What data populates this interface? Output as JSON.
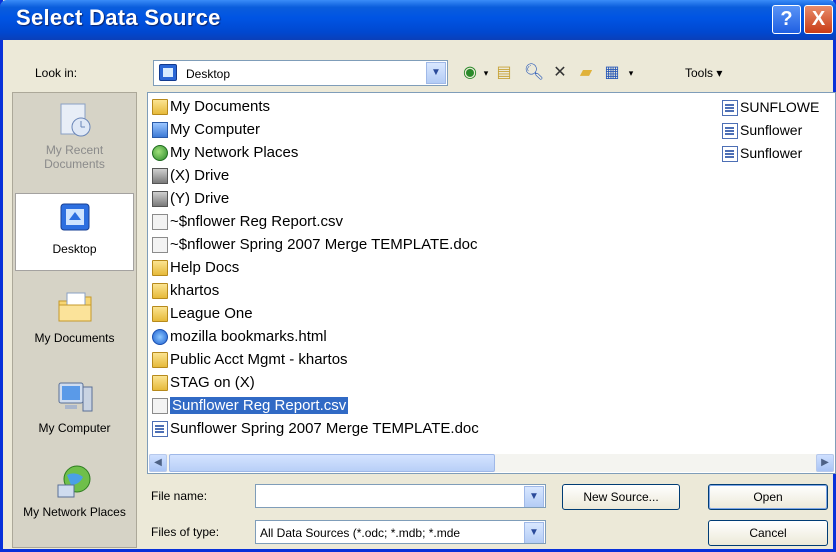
{
  "window": {
    "title": "Select Data Source",
    "help_glyph": "?",
    "close_glyph": "X"
  },
  "lookin": {
    "label": "Look in:",
    "value": "Desktop"
  },
  "toolbar": {
    "tools_label": "Tools"
  },
  "places": [
    {
      "label": "My Recent Documents",
      "icon": "recent-documents-icon",
      "disabled": true
    },
    {
      "label": "Desktop",
      "icon": "desktop-icon",
      "selected": true
    },
    {
      "label": "My Documents",
      "icon": "my-documents-icon"
    },
    {
      "label": "My Computer",
      "icon": "my-computer-icon"
    },
    {
      "label": "My Network Places",
      "icon": "network-places-icon"
    }
  ],
  "files_col1": [
    {
      "name": "My Documents",
      "icon": "folder"
    },
    {
      "name": "My Computer",
      "icon": "computer"
    },
    {
      "name": "My Network Places",
      "icon": "network"
    },
    {
      "name": "(X) Drive",
      "icon": "drive"
    },
    {
      "name": "(Y) Drive",
      "icon": "drive"
    },
    {
      "name": "~$nflower Reg Report.csv",
      "icon": "csv"
    },
    {
      "name": "~$nflower Spring 2007 Merge TEMPLATE.doc",
      "icon": "csv"
    },
    {
      "name": "Help Docs",
      "icon": "folder"
    },
    {
      "name": "khartos",
      "icon": "folder"
    },
    {
      "name": "League One",
      "icon": "folder"
    },
    {
      "name": "mozilla bookmarks.html",
      "icon": "ie"
    },
    {
      "name": "Public Acct Mgmt - khartos",
      "icon": "folder"
    },
    {
      "name": "STAG on (X)",
      "icon": "folder"
    },
    {
      "name": "Sunflower Reg Report.csv",
      "icon": "csv",
      "selected": true
    },
    {
      "name": "Sunflower Spring 2007 Merge TEMPLATE.doc",
      "icon": "doc"
    }
  ],
  "files_col2": [
    {
      "name": "SUNFLOWE",
      "icon": "doc"
    },
    {
      "name": "Sunflower",
      "icon": "doc"
    },
    {
      "name": "Sunflower",
      "icon": "doc"
    }
  ],
  "filename": {
    "label": "File name:",
    "value": ""
  },
  "filetype": {
    "label": "Files of type:",
    "value": "All Data Sources (*.odc; *.mdb; *.mde"
  },
  "buttons": {
    "new_source": "New Source...",
    "open": "Open",
    "cancel": "Cancel"
  }
}
